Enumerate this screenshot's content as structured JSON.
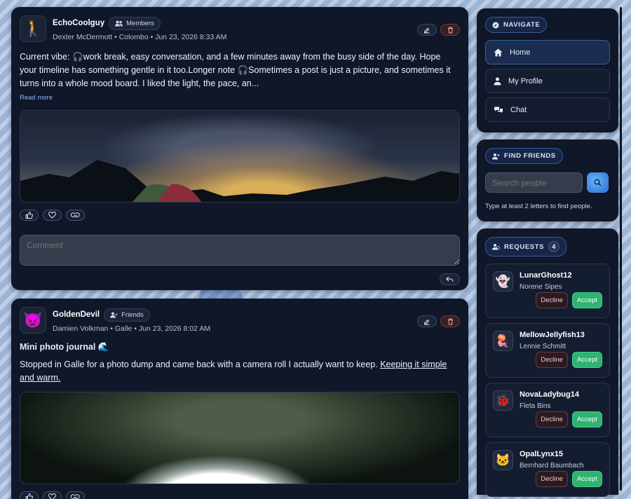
{
  "posts": [
    {
      "username": "EchoCoolguy",
      "avatar_icon": "walking-person-icon",
      "audience": "Members",
      "meta": "Dexter McDermott • Colombo • Jun 23, 2026 8:33 AM",
      "text": "Current vibe: 🎧work break, easy conversation, and a few minutes away from the busy side of the day. Hope your timeline has something gentle in it too.Longer note 🎧Sometimes a post is just a picture, and sometimes it turns into a whole mood board. I liked the light, the pace, an...",
      "read_more": "Read more",
      "comment_placeholder": "Comment"
    },
    {
      "username": "GoldenDevil",
      "avatar_icon": "devil-face-icon",
      "audience": "Friends",
      "meta": "Damien Volkman • Galle • Jun 23, 2026 8:02 AM",
      "title": "Mini photo journal 🌊",
      "text": "Stopped in Galle for a photo dump and came back with a camera roll I actually want to keep. ",
      "link_text": "Keeping it simple and warm."
    }
  ],
  "navigate": {
    "tag": "NAVIGATE",
    "items": [
      {
        "label": "Home",
        "icon": "home-icon",
        "active": true
      },
      {
        "label": "My Profile",
        "icon": "user-icon",
        "active": false
      },
      {
        "label": "Chat",
        "icon": "chat-icon",
        "active": false
      }
    ]
  },
  "find_friends": {
    "tag": "FIND FRIENDS",
    "placeholder": "Search people",
    "hint": "Type at least 2 letters to find people."
  },
  "requests": {
    "tag": "REQUESTS",
    "count": "4",
    "decline_label": "Decline",
    "accept_label": "Accept",
    "items": [
      {
        "username": "LunarGhost12",
        "name": "Norene Sipes",
        "avatar_icon": "ghost-icon"
      },
      {
        "username": "MellowJellyfish13",
        "name": "Lennie Schmitt",
        "avatar_icon": "jellyfish-icon"
      },
      {
        "username": "NovaLadybug14",
        "name": "Fleta Bins",
        "avatar_icon": "ladybug-icon"
      },
      {
        "username": "OpalLynx15",
        "name": "Bernhard Baumbach",
        "avatar_icon": "lynx-icon"
      }
    ]
  },
  "colors": {
    "card": "#0f1729",
    "accent": "#2fb372",
    "link": "#8fb6ff"
  }
}
